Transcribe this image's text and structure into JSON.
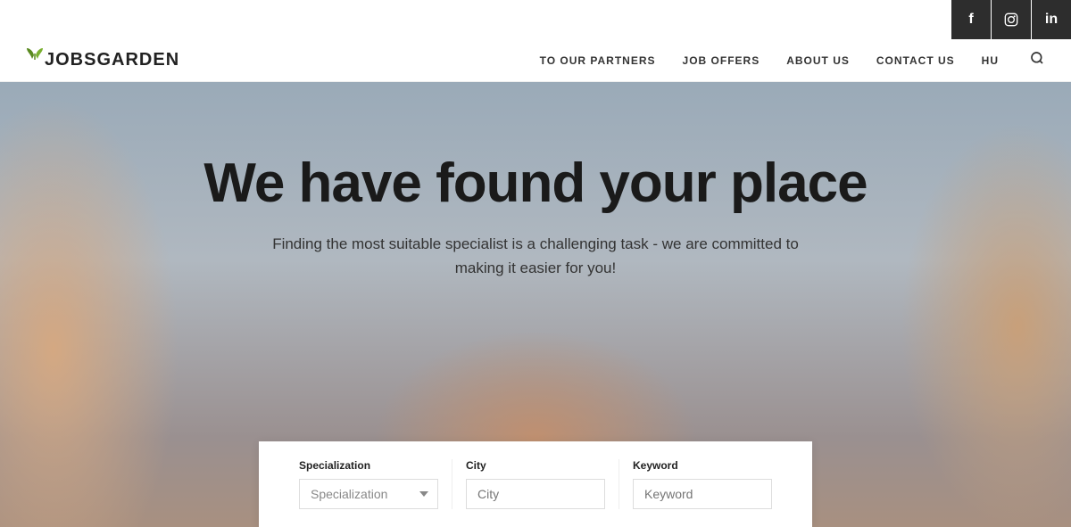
{
  "social": {
    "facebook_label": "f",
    "instagram_label": "📷",
    "linkedin_label": "in"
  },
  "logo": {
    "text": "JOBSGARDEN"
  },
  "nav": {
    "items": [
      {
        "label": "TO OUR PARTNERS",
        "id": "to-our-partners"
      },
      {
        "label": "JOB OFFERS",
        "id": "job-offers"
      },
      {
        "label": "ABOUT US",
        "id": "about-us"
      },
      {
        "label": "CONTACT US",
        "id": "contact-us"
      },
      {
        "label": "HU",
        "id": "hu"
      }
    ]
  },
  "hero": {
    "title": "We have found your place",
    "subtitle": "Finding the most suitable specialist is a challenging task - we are committed to making it easier for you!"
  },
  "search": {
    "specialization": {
      "label": "Specialization",
      "placeholder": "Specialization",
      "options": [
        "Specialization"
      ]
    },
    "city": {
      "label": "City",
      "placeholder": "City"
    },
    "keyword": {
      "label": "Keyword",
      "placeholder": "Keyword"
    }
  }
}
